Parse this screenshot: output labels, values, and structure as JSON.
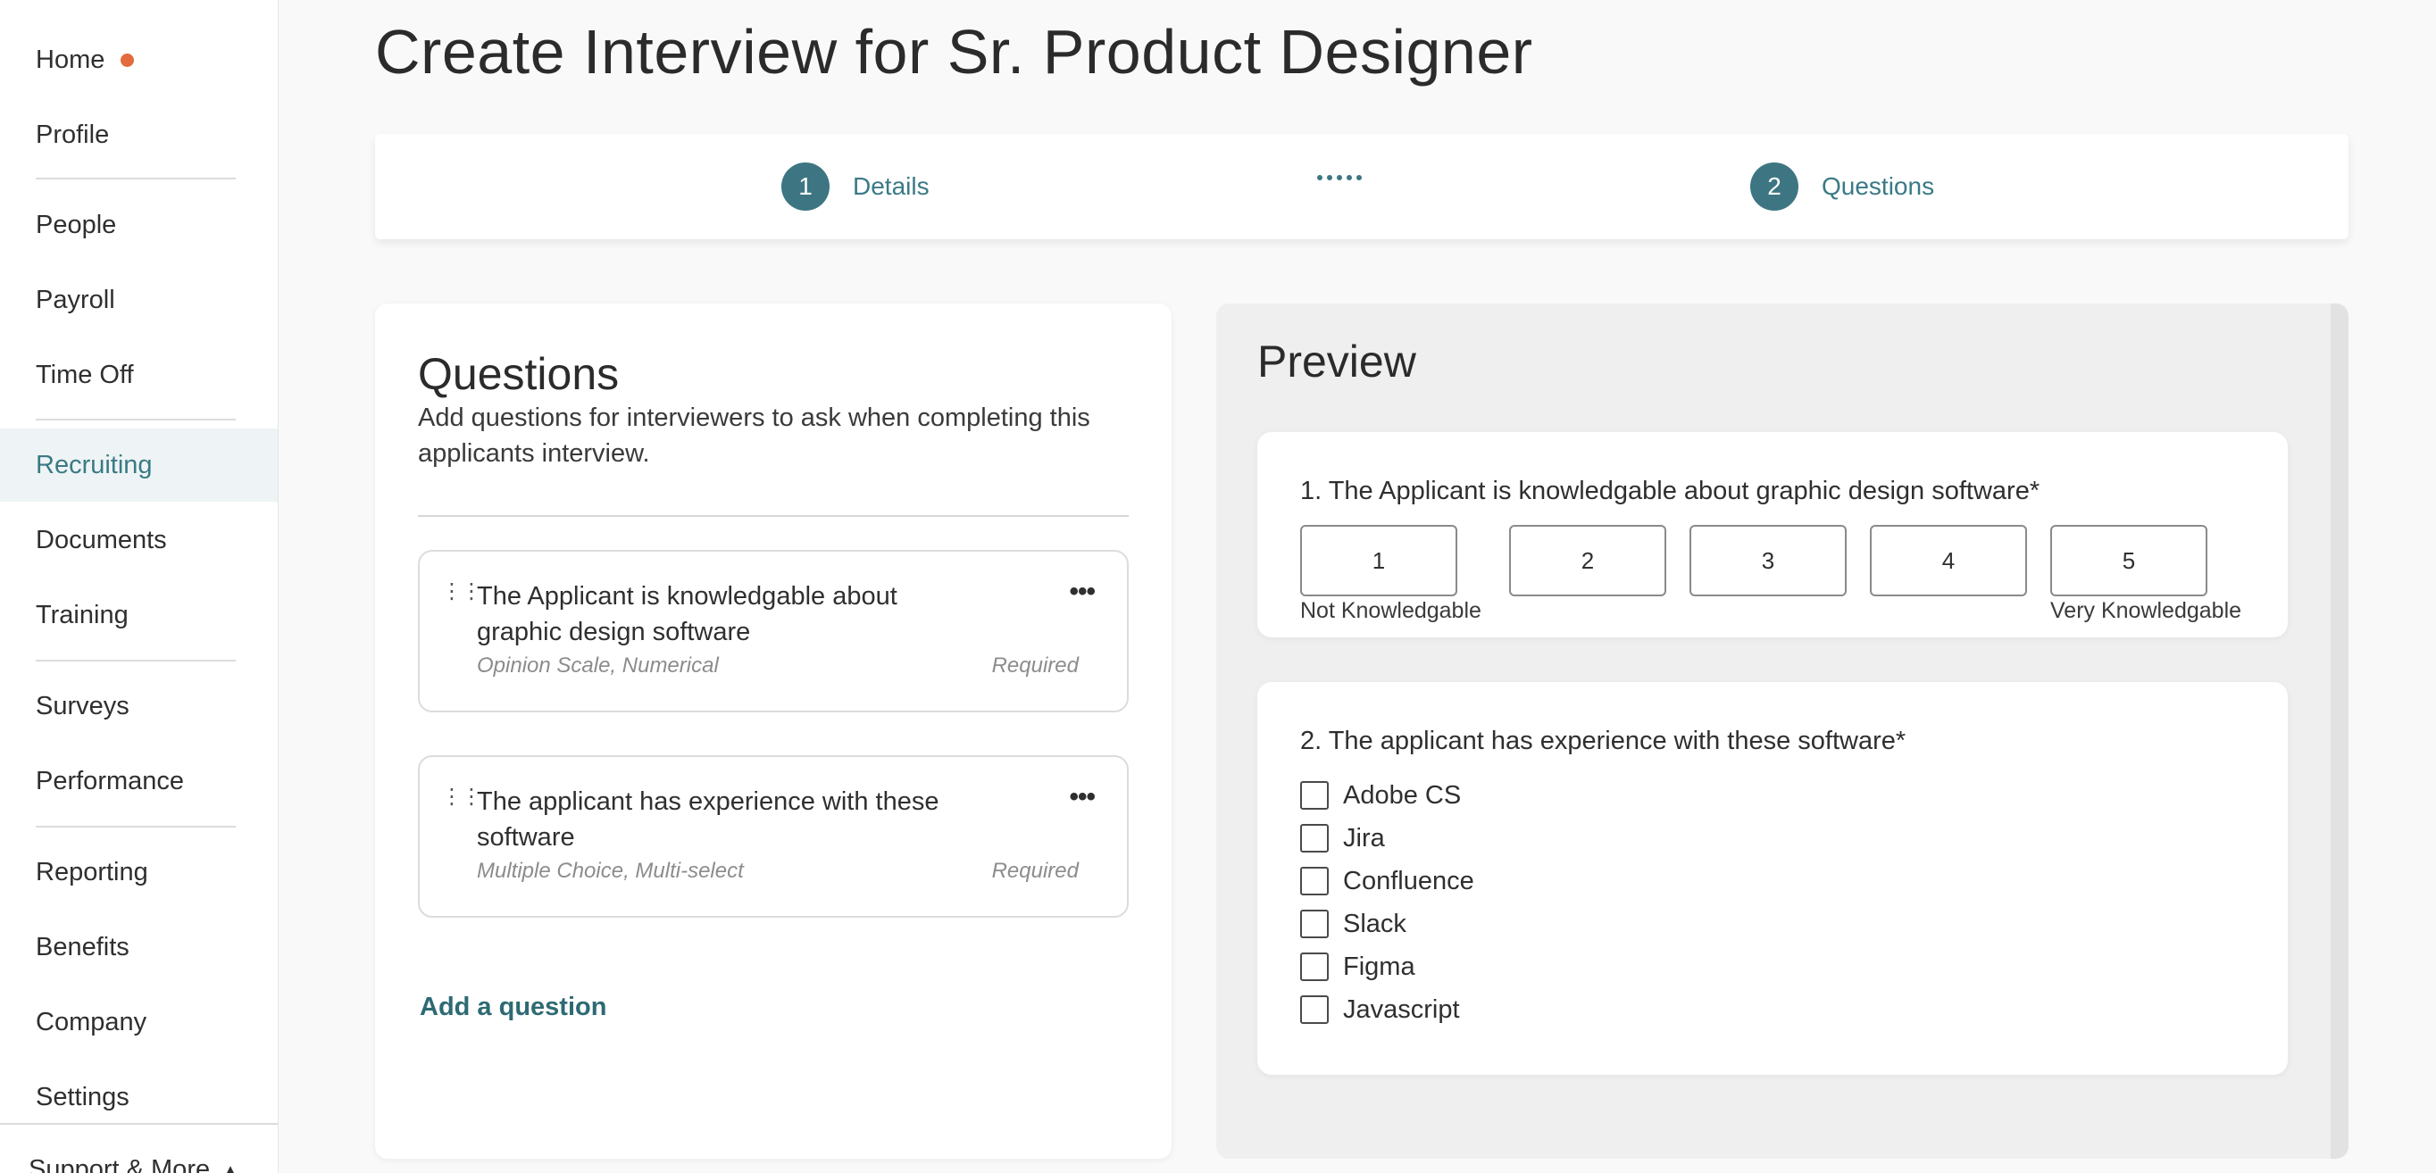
{
  "sidebar": {
    "items": [
      {
        "label": "Home"
      },
      {
        "label": "Profile"
      },
      {
        "label": "People"
      },
      {
        "label": "Payroll"
      },
      {
        "label": "Time Off"
      },
      {
        "label": "Recruiting"
      },
      {
        "label": "Documents"
      },
      {
        "label": "Training"
      },
      {
        "label": "Surveys"
      },
      {
        "label": "Performance"
      },
      {
        "label": "Reporting"
      },
      {
        "label": "Benefits"
      },
      {
        "label": "Company"
      },
      {
        "label": "Settings"
      }
    ],
    "active_item": "Recruiting",
    "support_label": "Support & More"
  },
  "page": {
    "title": "Create Interview for Sr. Product Designer"
  },
  "stepper": {
    "steps": [
      {
        "number": "1",
        "label": "Details"
      },
      {
        "number": "2",
        "label": "Questions"
      }
    ]
  },
  "questions_panel": {
    "heading": "Questions",
    "description": "Add questions for interviewers to ask when completing this applicants interview.",
    "questions": [
      {
        "title": "The Applicant is knowledgable about graphic design software",
        "type": "Opinion Scale, Numerical",
        "required": "Required"
      },
      {
        "title": "The applicant has experience with these software",
        "type": "Multiple Choice, Multi-select",
        "required": "Required"
      }
    ],
    "add_label": "Add a question"
  },
  "preview": {
    "heading": "Preview",
    "q1": {
      "text": "1. The Applicant is knowledgable about graphic design software*",
      "options": [
        "1",
        "2",
        "3",
        "4",
        "5"
      ],
      "low_label": "Not Knowledgable",
      "high_label": "Very Knowledgable"
    },
    "q2": {
      "text": "2. The applicant has experience with these software*",
      "options": [
        "Adobe CS",
        "Jira",
        "Confluence",
        "Slack",
        "Figma",
        "Javascript"
      ]
    }
  },
  "colors": {
    "accent": "#3d7682",
    "link": "#2e6a73",
    "notification_dot": "#e36b3c",
    "active_nav_bg": "#eef4f5"
  }
}
